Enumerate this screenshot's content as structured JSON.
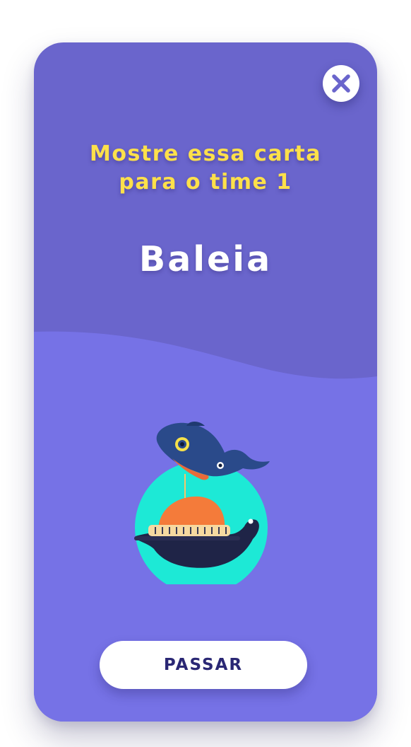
{
  "card": {
    "instruction_line1": "Mostre essa carta",
    "instruction_line2": "para o time 1",
    "word": "Baleia",
    "illustration_alt": "Baleia",
    "pass_label": "PASSAR"
  },
  "icons": {
    "close": "close-x-icon"
  },
  "colors": {
    "card_top": "#6a65cc",
    "card_bottom": "#7672e6",
    "instruction_text": "#fde04a",
    "word_text": "#ffffff",
    "button_bg": "#ffffff",
    "button_text": "#2a2774",
    "close_icon": "#6a65cc"
  }
}
